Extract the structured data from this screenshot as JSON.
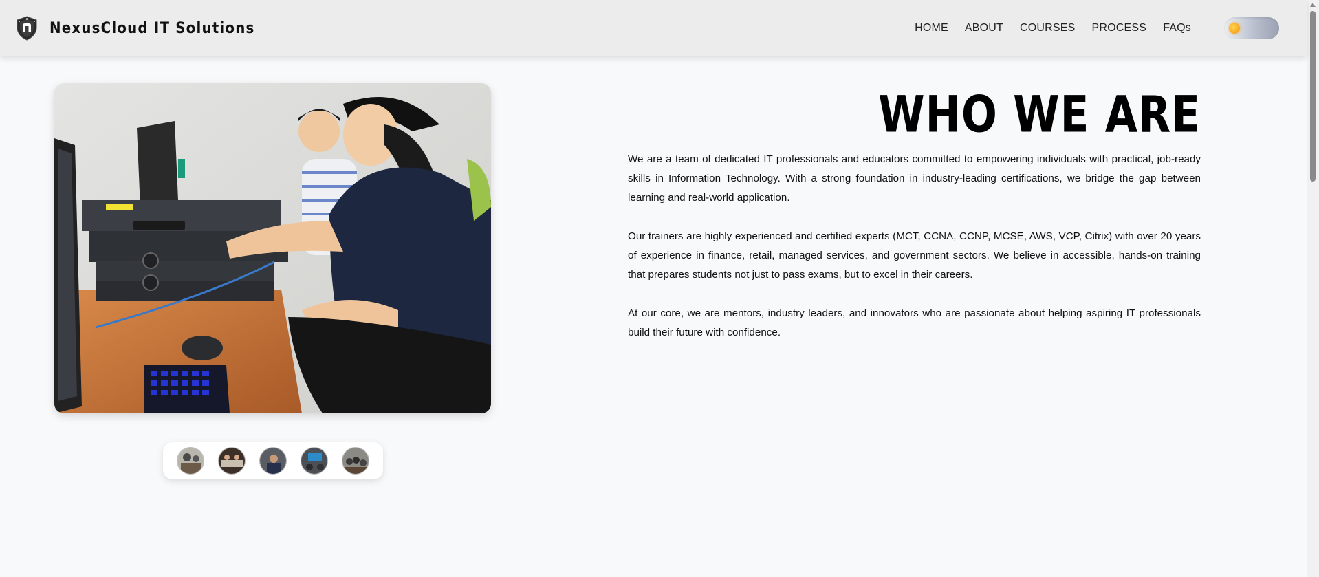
{
  "header": {
    "brand_name": "NexusCloud IT Solutions",
    "nav": [
      "HOME",
      "ABOUT",
      "COURSES",
      "PROCESS",
      "FAQs"
    ],
    "theme_toggle": "sun-icon"
  },
  "about": {
    "title": "WHO WE ARE",
    "paragraphs": [
      "We are a team of dedicated IT professionals and educators committed to empowering individuals with practical, job-ready skills in Information Technology. With a strong foundation in industry-leading certifications, we bridge the gap between learning and real-world application.",
      "Our trainers are highly experienced and certified experts (MCT, CCNA, CCNP, MCSE, AWS, VCP, Citrix) with over 20 years of experience in finance, retail, managed services, and government sectors. We believe in accessible, hands-on training that prepares students not just to pass exams, but to excel in their careers.",
      "At our core, we are mentors, industry leaders, and innovators who are passionate about helping aspiring IT professionals build their future with confidence."
    ]
  },
  "gallery": {
    "thumbnail_count": 5,
    "selected_index": 0
  },
  "colors": {
    "page_bg": "#f8f9fb",
    "header_bg": "#ececec",
    "toggle_sun": "#f5a623"
  }
}
